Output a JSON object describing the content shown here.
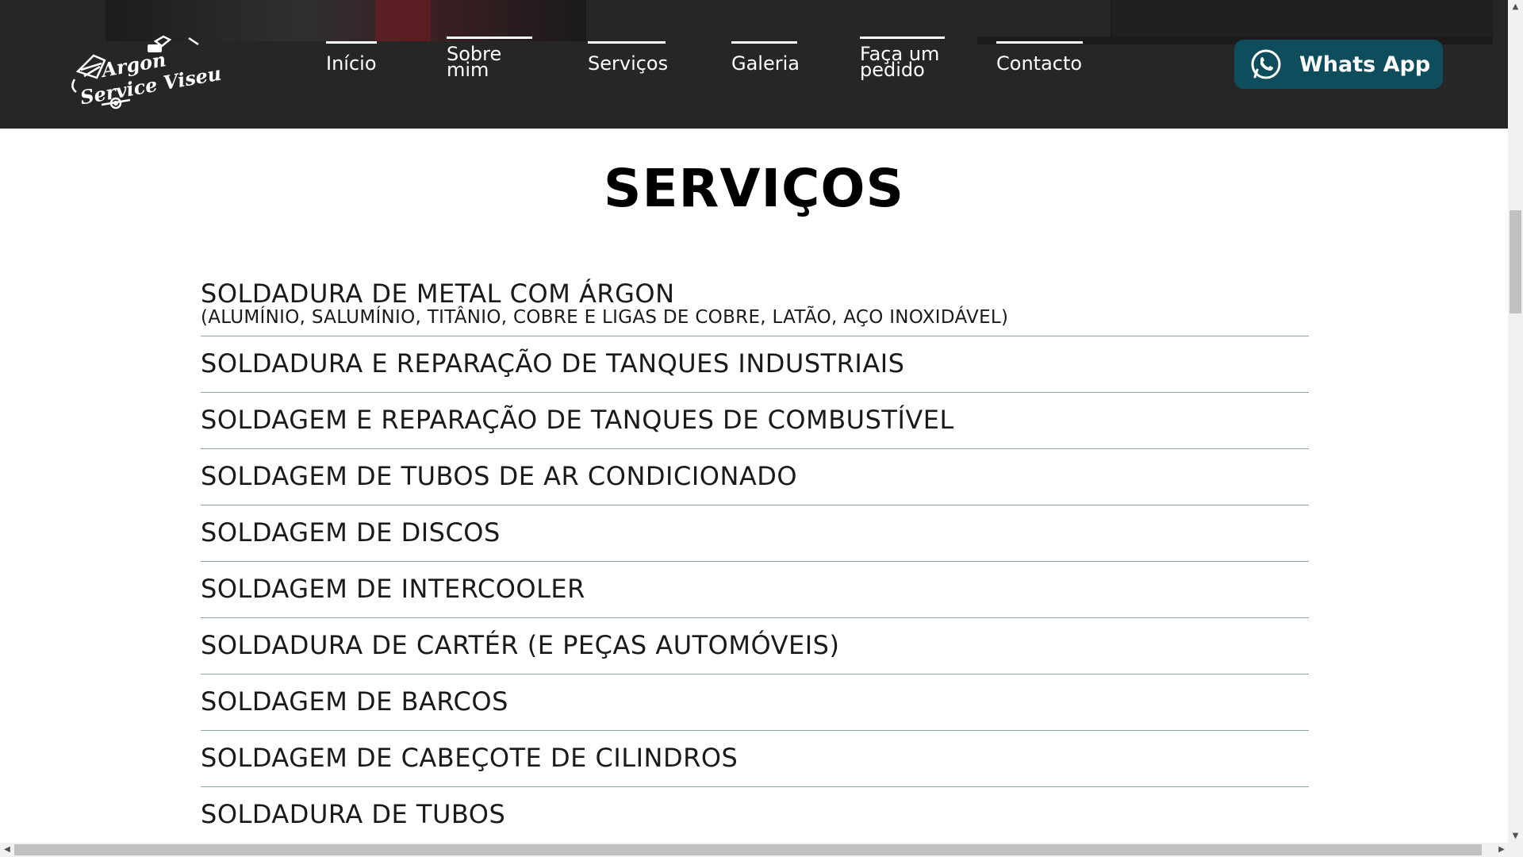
{
  "header": {
    "logo": {
      "line1": "Argon",
      "line2": "Service Viseu"
    },
    "nav": [
      {
        "label": "Início",
        "active": false
      },
      {
        "label": "Sobre mim",
        "active": false
      },
      {
        "label": "Serviços",
        "active": true
      },
      {
        "label": "Galeria",
        "active": false
      },
      {
        "label": "Faça um pedido",
        "active": false
      },
      {
        "label": "Contacto",
        "active": false
      }
    ],
    "whatsapp": {
      "label": "Whats App",
      "icon": "whatsapp-icon",
      "color": "#0d4d5c"
    }
  },
  "main": {
    "title": "SERVIÇOS",
    "services": [
      {
        "name": "SOLDADURA DE METAL COM ÁRGON",
        "detail": "(ALUMÍNIO, SALUMÍNIO, TITÂNIO, COBRE E LIGAS DE COBRE, LATÃO, AÇO INOXIDÁVEL)"
      },
      {
        "name": "SOLDADURA E REPARAÇÃO DE TANQUES INDUSTRIAIS"
      },
      {
        "name": "SOLDAGEM E REPARAÇÃO DE TANQUES DE COMBUSTÍVEL"
      },
      {
        "name": "SOLDAGEM DE TUBOS DE AR CONDICIONADO"
      },
      {
        "name": "SOLDAGEM DE DISCOS"
      },
      {
        "name": "SOLDAGEM DE INTERCOOLER"
      },
      {
        "name": "SOLDADURA DE CARTÉR (E PEÇAS AUTOMÓVEIS)"
      },
      {
        "name": "SOLDAGEM DE BARCOS"
      },
      {
        "name": "SOLDAGEM DE CABEÇOTE DE CILINDROS"
      },
      {
        "name": "SOLDADURA DE TUBOS"
      }
    ]
  },
  "colors": {
    "header_bg": "#262626",
    "divider": "#8fa3a8",
    "text": "#1a1a1a"
  }
}
